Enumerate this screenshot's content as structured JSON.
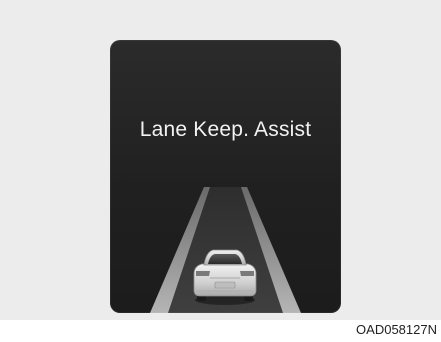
{
  "display": {
    "title": "Lane Keep. Assist",
    "scene_icon": "car-rear-in-lane-icon"
  },
  "figure": {
    "code": "OAD058127N"
  },
  "colors": {
    "background": "#ececec",
    "screen": "#222222",
    "text": "#f2f2f2",
    "lane_line": "#9a9a9a",
    "lane_surface": "#3a3a3a",
    "car_body": "#d9d9d9"
  }
}
